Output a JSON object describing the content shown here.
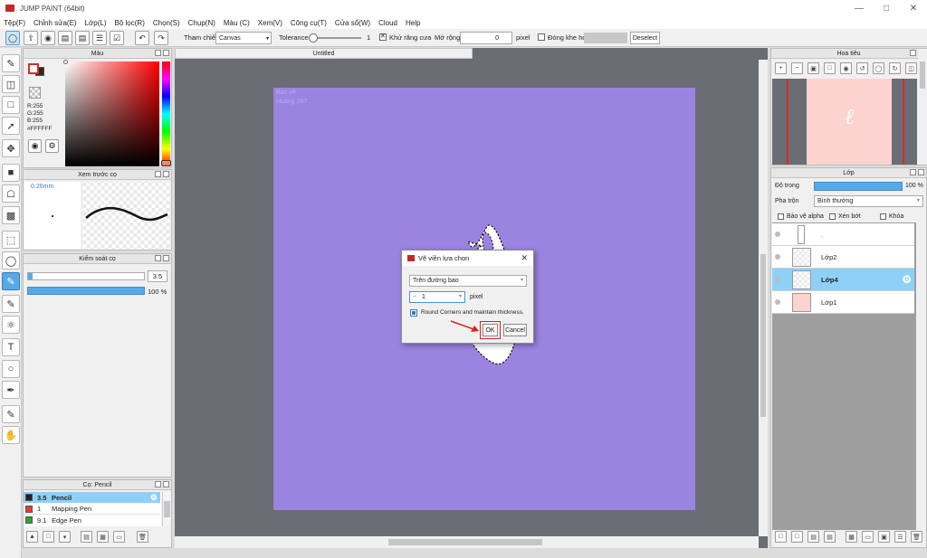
{
  "app": {
    "title": "JUMP PAINT (64bit)"
  },
  "menu": {
    "items": [
      "Tệp(F)",
      "Chỉnh sửa(E)",
      "Lớp(L)",
      "Bộ lọc(R)",
      "Chọn(S)",
      "Chụp(N)",
      "Màu (C)",
      "Xem(V)",
      "Công cụ(T)",
      "Cửa sổ(W)",
      "Cloud",
      "Help"
    ]
  },
  "toolbar": {
    "reference_label": "Tham chiếu",
    "reference_value": "Canvas",
    "tolerance_label": "Tolerance",
    "tolerance_value": "1",
    "antialias_label": "Khử răng cưa",
    "expand_label": "Mở rộng",
    "expand_value": "0",
    "expand_unit": "pixel",
    "gap_close_label": "Đóng khe hở",
    "deselect_label": "Deselect"
  },
  "color_panel": {
    "title": "Màu",
    "r": "R:255",
    "g": "G:255",
    "b": "B:255",
    "hex": "#FFFFFF",
    "primary_color": "#ffffff",
    "secondary_color": "#3a2415"
  },
  "brush_preview": {
    "title": "Xem trước cọ",
    "size": "0.26mm"
  },
  "brush_control": {
    "title": "Kiểm soát cọ",
    "size_value": "3.5",
    "opacity_value": "100 %"
  },
  "brush_list": {
    "title": "Cọ: Pencil",
    "items": [
      {
        "size": "3.5",
        "name": "Pencil",
        "color": "#222222",
        "selected": true
      },
      {
        "size": "1",
        "name": "Mapping Pen",
        "color": "#e53935",
        "selected": false
      },
      {
        "size": "9.1",
        "name": "Edge Pen",
        "color": "#22aa22",
        "selected": false
      }
    ]
  },
  "document": {
    "tab": "Untitled",
    "canvas_color": "#9b84e0",
    "watermark_line1": "Bản vẽ",
    "watermark_line2": "Hoàng 2h7"
  },
  "dialog": {
    "title": "Vẽ viền lựa chọn",
    "position_value": "Trên đường bao",
    "width_value": "1",
    "width_unit": "pixel",
    "round_corners_label": "Round Corners and maintain thickness.",
    "ok_label": "OK",
    "cancel_label": "Cancel"
  },
  "navigator": {
    "title": "Hoa tiêu",
    "preview_letter": "ℓ"
  },
  "layers": {
    "title": "Lớp",
    "opacity_label": "Độ trong",
    "opacity_value": "100 %",
    "blend_label": "Pha trộn",
    "blend_value": "Bình thường",
    "protect_alpha_label": "Bảo vệ alpha",
    "clip_label": "Xén bớt",
    "lock_label": "Khóa",
    "items": [
      {
        "name": ".",
        "selected": false,
        "thumb": "#ffffff"
      },
      {
        "name": "Lớp2",
        "selected": false,
        "thumb": "checker"
      },
      {
        "name": "Lớp4",
        "selected": true,
        "thumb": "checker"
      },
      {
        "name": "Lớp1",
        "selected": false,
        "thumb": "#fbd3cf"
      }
    ]
  }
}
